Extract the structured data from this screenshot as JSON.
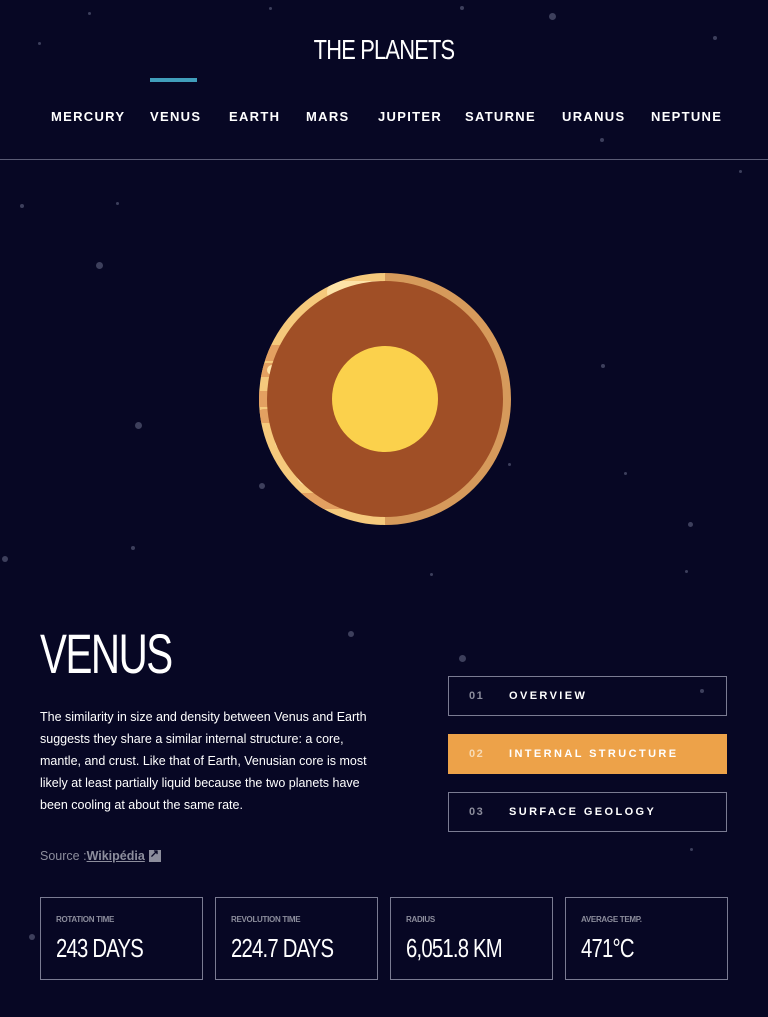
{
  "header": {
    "logo": "THE PLANETS",
    "nav": [
      "MERCURY",
      "VENUS",
      "EARTH",
      "MARS",
      "JUPITER",
      "SATURNE",
      "URANUS",
      "NEPTUNE"
    ],
    "active": "VENUS"
  },
  "planet": {
    "name": "VENUS",
    "description": "The similarity in size and density between Venus and Earth suggests they share a similar internal structure: a core, mantle, and crust. Like that of Earth, Venusian core is most likely at least partially liquid because the two planets have been cooling at about the same rate.",
    "source_prefix": "Source :",
    "source_link": "Wikipédia"
  },
  "tabs": [
    {
      "num": "01",
      "label": "OVERVIEW"
    },
    {
      "num": "02",
      "label": "INTERNAL STRUCTURE"
    },
    {
      "num": "03",
      "label": "SURFACE GEOLOGY"
    }
  ],
  "active_tab": "INTERNAL STRUCTURE",
  "stats": [
    {
      "label": "ROTATION TIME",
      "value": "243 DAYS"
    },
    {
      "label": "REVOLUTION TIME",
      "value": "224.7 DAYS"
    },
    {
      "label": "RADIUS",
      "value": "6,051.8 KM"
    },
    {
      "label": "AVERAGE TEMP.",
      "value": "471°C"
    }
  ],
  "colors": {
    "background": "#070724",
    "accent_nav": "#419EBB",
    "accent_tab": "#EDA249"
  }
}
